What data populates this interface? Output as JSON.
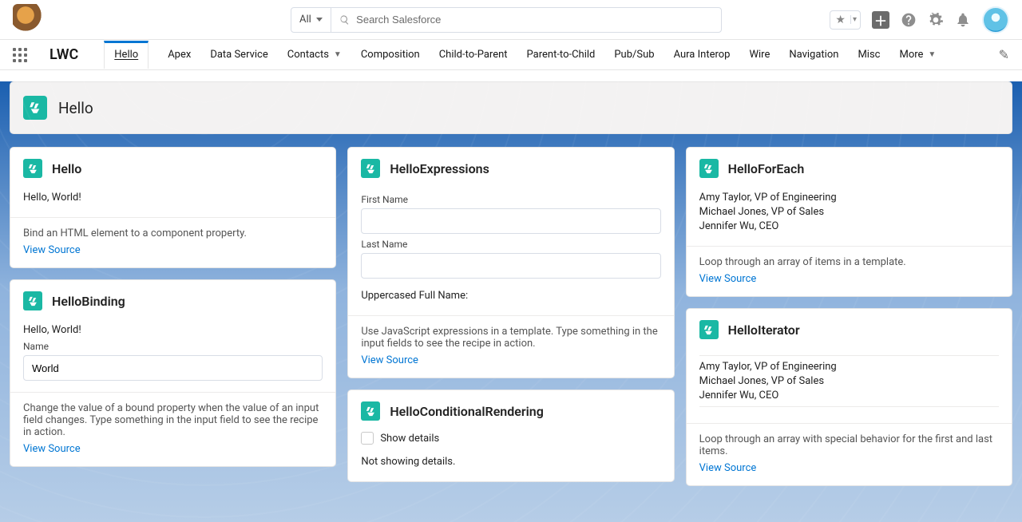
{
  "header": {
    "search_scope": "All",
    "search_placeholder": "Search Salesforce"
  },
  "app": {
    "name": "LWC"
  },
  "tabs": [
    {
      "label": "Hello",
      "active": true,
      "hasMenu": false
    },
    {
      "label": "Apex"
    },
    {
      "label": "Data Service"
    },
    {
      "label": "Contacts",
      "hasMenu": true
    },
    {
      "label": "Composition"
    },
    {
      "label": "Child-to-Parent"
    },
    {
      "label": "Parent-to-Child"
    },
    {
      "label": "Pub/Sub"
    },
    {
      "label": "Aura Interop"
    },
    {
      "label": "Wire"
    },
    {
      "label": "Navigation"
    },
    {
      "label": "Misc"
    },
    {
      "label": "More",
      "hasMenu": true
    }
  ],
  "page": {
    "title": "Hello"
  },
  "links": {
    "view_source": "View Source"
  },
  "cards": {
    "hello": {
      "title": "Hello",
      "body": "Hello, World!",
      "desc": "Bind an HTML element to a component property."
    },
    "helloBinding": {
      "title": "HelloBinding",
      "greeting": "Hello, World!",
      "name_label": "Name",
      "name_value": "World",
      "desc": "Change the value of a bound property when the value of an input field changes. Type something in the input field to see the recipe in action."
    },
    "helloExpressions": {
      "title": "HelloExpressions",
      "first_name_label": "First Name",
      "last_name_label": "Last Name",
      "upper_label": "Uppercased Full Name:",
      "desc": "Use JavaScript expressions in a template. Type something in the input fields to see the recipe in action."
    },
    "helloConditional": {
      "title": "HelloConditionalRendering",
      "show_details_label": "Show details",
      "status": "Not showing details."
    },
    "helloForEach": {
      "title": "HelloForEach",
      "items": [
        "Amy Taylor, VP of Engineering",
        "Michael Jones, VP of Sales",
        "Jennifer Wu, CEO"
      ],
      "desc": "Loop through an array of items in a template."
    },
    "helloIterator": {
      "title": "HelloIterator",
      "items": [
        "Amy Taylor, VP of Engineering",
        "Michael Jones, VP of Sales",
        "Jennifer Wu, CEO"
      ],
      "desc": "Loop through an array with special behavior for the first and last items."
    }
  }
}
